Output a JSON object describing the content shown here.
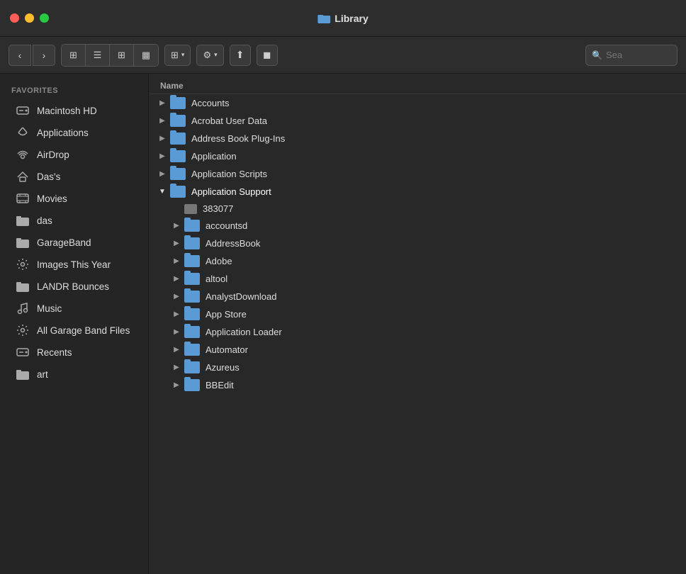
{
  "titlebar": {
    "title": "Library",
    "traffic_lights": [
      "red",
      "yellow",
      "green"
    ]
  },
  "toolbar": {
    "back_label": "‹",
    "forward_label": "›",
    "view_icons": [
      "⊞",
      "☰",
      "⊟",
      "⊟"
    ],
    "view_dropdown_label": "⊞",
    "action_dropdown_label": "⚙",
    "share_label": "⬆",
    "tag_label": "◼",
    "search_placeholder": "Sea"
  },
  "sidebar": {
    "section_label": "Favorites",
    "items": [
      {
        "id": "macintosh-hd",
        "label": "Macintosh HD",
        "icon": "💾"
      },
      {
        "id": "applications",
        "label": "Applications",
        "icon": "🅰"
      },
      {
        "id": "airdrop",
        "label": "AirDrop",
        "icon": "📡"
      },
      {
        "id": "dass",
        "label": "Das's",
        "icon": "🏠"
      },
      {
        "id": "movies",
        "label": "Movies",
        "icon": "🎬"
      },
      {
        "id": "das",
        "label": "das",
        "icon": "📁"
      },
      {
        "id": "garageband",
        "label": "GarageBand",
        "icon": "📁"
      },
      {
        "id": "images-this-year",
        "label": "Images This Year",
        "icon": "⚙"
      },
      {
        "id": "landr-bounces",
        "label": "LANDR Bounces",
        "icon": "📁"
      },
      {
        "id": "music",
        "label": "Music",
        "icon": "🎵"
      },
      {
        "id": "all-garage-band-files",
        "label": "All Garage Band Files",
        "icon": "⚙"
      },
      {
        "id": "recents",
        "label": "Recents",
        "icon": "💾"
      },
      {
        "id": "art",
        "label": "art",
        "icon": "📁"
      }
    ]
  },
  "file_list": {
    "header": "Name",
    "items": [
      {
        "id": "accounts",
        "name": "Accounts",
        "type": "folder",
        "level": 0,
        "expanded": false
      },
      {
        "id": "acrobat-user-data",
        "name": "Acrobat User Data",
        "type": "folder",
        "level": 0,
        "expanded": false
      },
      {
        "id": "address-book-plug-ins",
        "name": "Address Book Plug-Ins",
        "type": "folder",
        "level": 0,
        "expanded": false
      },
      {
        "id": "application",
        "name": "Application",
        "type": "folder",
        "level": 0,
        "expanded": false
      },
      {
        "id": "application-scripts",
        "name": "Application Scripts",
        "type": "folder",
        "level": 0,
        "expanded": false
      },
      {
        "id": "application-support",
        "name": "Application Support",
        "type": "folder",
        "level": 0,
        "expanded": true
      },
      {
        "id": "383077",
        "name": "383077",
        "type": "file",
        "level": 1,
        "expanded": false
      },
      {
        "id": "accountsd",
        "name": "accountsd",
        "type": "folder",
        "level": 1,
        "expanded": false
      },
      {
        "id": "addressbook",
        "name": "AddressBook",
        "type": "folder",
        "level": 1,
        "expanded": false
      },
      {
        "id": "adobe",
        "name": "Adobe",
        "type": "folder",
        "level": 1,
        "expanded": false
      },
      {
        "id": "altool",
        "name": "altool",
        "type": "folder",
        "level": 1,
        "expanded": false
      },
      {
        "id": "analystdownload",
        "name": "AnalystDownload",
        "type": "folder",
        "level": 1,
        "expanded": false
      },
      {
        "id": "app-store",
        "name": "App Store",
        "type": "folder",
        "level": 1,
        "expanded": false
      },
      {
        "id": "application-loader",
        "name": "Application Loader",
        "type": "folder",
        "level": 1,
        "expanded": false
      },
      {
        "id": "automator",
        "name": "Automator",
        "type": "folder",
        "level": 1,
        "expanded": false
      },
      {
        "id": "azureus",
        "name": "Azureus",
        "type": "folder",
        "level": 1,
        "expanded": false
      },
      {
        "id": "bbedit",
        "name": "BBEdit",
        "type": "folder",
        "level": 1,
        "expanded": false
      }
    ]
  }
}
